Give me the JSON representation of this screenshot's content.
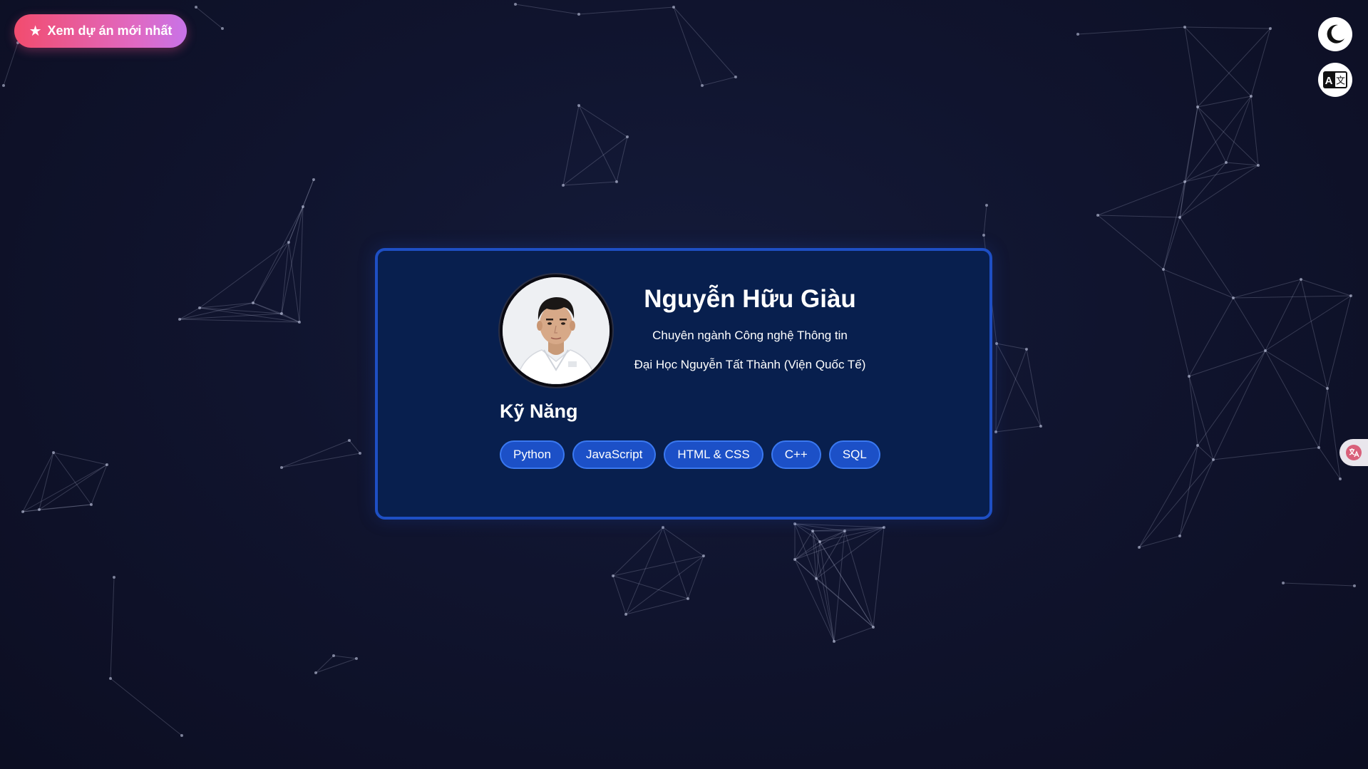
{
  "header": {
    "latest_project_label": "Xem dự án mới nhất",
    "latest_project_icon": "star-icon"
  },
  "controls": {
    "theme_icon": "moon-icon",
    "language_icon": "translate-icon",
    "language_letter": "A",
    "language_glyph": "文"
  },
  "profile": {
    "name": "Nguyễn Hữu Giàu",
    "major": "Chuyên ngành Công nghệ Thông tin",
    "school": "Đại Học Nguyễn Tất Thành (Viện Quốc Tế)",
    "avatar_icon": "profile-photo"
  },
  "skills": {
    "title": "Kỹ Năng",
    "items": [
      "Python",
      "JavaScript",
      "HTML & CSS",
      "C++",
      "SQL"
    ]
  },
  "colors": {
    "card_border": "#1e4fc4",
    "card_background": "#081f4e",
    "skill_background": "#1c50c7",
    "button_gradient_start": "#f24c6e",
    "button_gradient_end": "#c873e8"
  }
}
